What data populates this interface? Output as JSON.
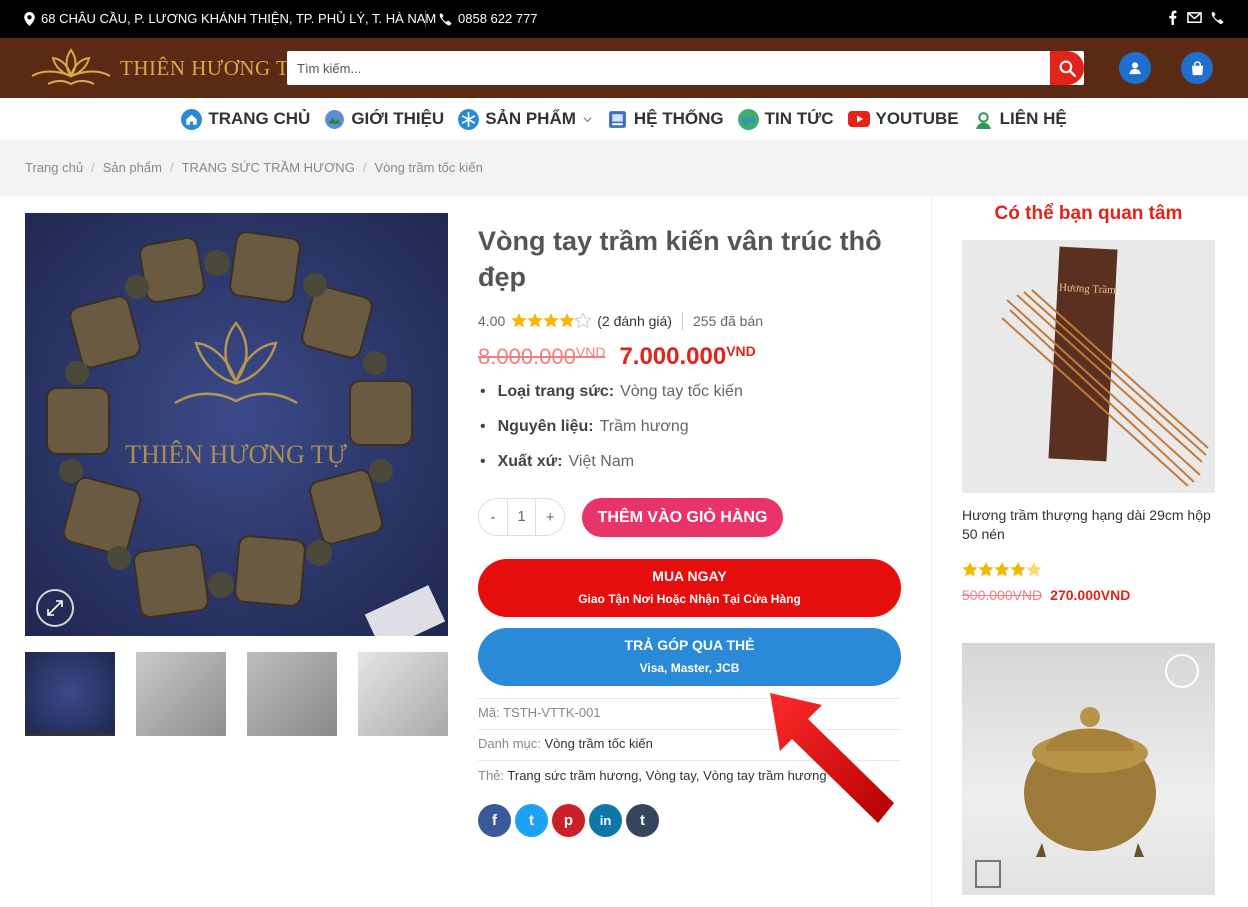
{
  "topbar": {
    "address": "68 CHÂU CẦU, P. LƯƠNG KHÁNH THIỆN, TP. PHỦ LÝ, T. HÀ NAM",
    "phone": "0858 622 777",
    "social_icons": [
      "facebook-icon",
      "email-icon",
      "phone-icon"
    ]
  },
  "header": {
    "logo_text": "THIÊN HƯƠNG TỰ",
    "search_placeholder": "Tìm kiếm...",
    "icons": [
      "user-icon",
      "cart-icon"
    ]
  },
  "nav": [
    {
      "label": "TRANG CHỦ",
      "color": "#2b8ad8"
    },
    {
      "label": "GIỚI THIỆU",
      "color": "#4a7bd0"
    },
    {
      "label": "SẢN PHẨM",
      "color": "#2b8ad8"
    },
    {
      "label": "HỆ THỐNG",
      "color": "#3a6fc0"
    },
    {
      "label": "TIN TỨC",
      "color": "#3fae6a"
    },
    {
      "label": "YOUTUBE",
      "color": "#e62117"
    },
    {
      "label": "LIÊN HỆ",
      "color": "#2e9a55"
    }
  ],
  "breadcrumb": [
    "Trang chủ",
    "Sản phẩm",
    "TRANG SỨC TRẦM HƯƠNG",
    "Vòng trầm tốc kiến"
  ],
  "product": {
    "title": "Vòng tay trầm kiến vân trúc thô đẹp",
    "rating": "4.00",
    "stars": 4,
    "reviews": "(2 đánh giá)",
    "sold": "255 đã bán",
    "old_price": "8.000.000",
    "new_price": "7.000.000",
    "currency": "VND",
    "attributes": [
      {
        "key": "Loại trang sức:",
        "value": "Vòng tay tốc kiến"
      },
      {
        "key": "Nguyên liệu:",
        "value": "Trầm hương"
      },
      {
        "key": "Xuất xứ:",
        "value": "Việt Nam"
      }
    ],
    "quantity": "1",
    "minus": "-",
    "plus": "+",
    "add_to_cart": "THÊM VÀO GIỎ HÀNG",
    "buy_now": {
      "main": "MUA NGAY",
      "sub": "Giao Tận Nơi Hoặc Nhận Tại Cửa Hàng"
    },
    "installment": {
      "main": "TRẢ GÓP QUA THẺ",
      "sub": "Visa, Master, JCB"
    },
    "sku_label": "Mã:",
    "sku": "TSTH-VTTK-001",
    "category_label": "Danh mục:",
    "category": "Vòng trầm tốc kiến",
    "tags_label": "Thẻ:",
    "tags": "Trang sức trầm hương, Vòng tay, Vòng tay trầm hương",
    "image_watermark": "THIÊN HƯƠNG TỰ"
  },
  "share": [
    {
      "icon": "facebook-icon",
      "glyph": "f",
      "color": "#3b5998"
    },
    {
      "icon": "twitter-icon",
      "glyph": "t",
      "color": "#1da1f2"
    },
    {
      "icon": "pinterest-icon",
      "glyph": "p",
      "color": "#cb2027"
    },
    {
      "icon": "linkedin-icon",
      "glyph": "in",
      "color": "#0e76a8"
    },
    {
      "icon": "tumblr-icon",
      "glyph": "t",
      "color": "#35465c"
    }
  ],
  "sidebar": {
    "title": "Có thể bạn quan tâm",
    "item1": {
      "name": "Hương trầm thượng hạng dài 29cm hộp 50 nén",
      "stars": 4.5,
      "old_price": "500.000VND",
      "new_price": "270.000VND",
      "box_text": "Hương Trầm"
    }
  },
  "colors": {
    "header_bg": "#5a2a14",
    "accent_red": "#e2231a",
    "add_cart": "#e8336b",
    "installment": "#2b8ad8"
  }
}
